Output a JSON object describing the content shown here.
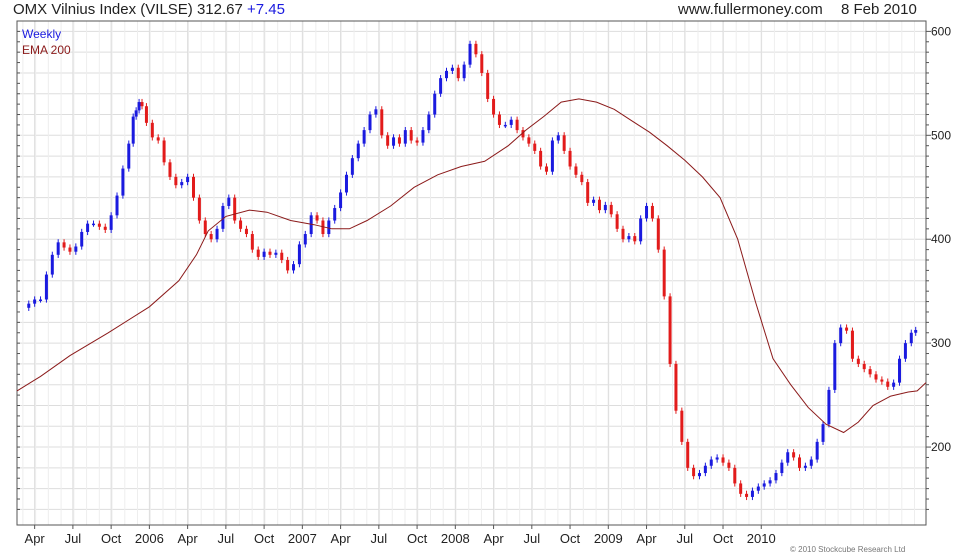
{
  "header": {
    "title": "OMX Vilnius Index (VILSE)",
    "last_price": "312.67",
    "change": "+7.45",
    "site": "www.fullermoney.com",
    "date": "8 Feb 2010"
  },
  "legend": {
    "weekly": "Weekly",
    "ema": "EMA 200"
  },
  "footer": {
    "copyright": "© 2010 Stockcube Research Ltd"
  },
  "colors": {
    "up": "#1a1adf",
    "down": "#e21b1b",
    "ema": "#8b1a1a",
    "grid": "#dddddd",
    "frame": "#555555"
  },
  "chart_data": {
    "type": "line",
    "title": "OMX Vilnius Index (VILSE)",
    "xlabel": "",
    "ylabel": "",
    "ylim": [
      125,
      610
    ],
    "y_ticks": [
      200,
      300,
      400,
      500,
      600
    ],
    "x_tick_labels": [
      "Apr",
      "Jul",
      "Oct",
      "2006",
      "Apr",
      "Jul",
      "Oct",
      "2007",
      "Apr",
      "Jul",
      "Oct",
      "2008",
      "Apr",
      "Jul",
      "Oct",
      "2009",
      "Apr",
      "Jul",
      "Oct",
      "2010"
    ],
    "x_tick_weeks": [
      3,
      16,
      29,
      42,
      55,
      68,
      81,
      94,
      107,
      120,
      133,
      146,
      159,
      172,
      185,
      198,
      211,
      224,
      237,
      250
    ],
    "grid": true,
    "series": [
      {
        "name": "Weekly",
        "points": [
          [
            0,
            334
          ],
          [
            2,
            338
          ],
          [
            4,
            342
          ],
          [
            6,
            342
          ],
          [
            8,
            366
          ],
          [
            10,
            385
          ],
          [
            12,
            397
          ],
          [
            14,
            392
          ],
          [
            16,
            388
          ],
          [
            18,
            393
          ],
          [
            20,
            407
          ],
          [
            22,
            415
          ],
          [
            24,
            415
          ],
          [
            26,
            412
          ],
          [
            28,
            409
          ],
          [
            30,
            423
          ],
          [
            32,
            442
          ],
          [
            34,
            468
          ],
          [
            36,
            492
          ],
          [
            37,
            518
          ],
          [
            38,
            524
          ],
          [
            39,
            532
          ],
          [
            40,
            528
          ],
          [
            42,
            512
          ],
          [
            44,
            498
          ],
          [
            46,
            495
          ],
          [
            48,
            474
          ],
          [
            50,
            460
          ],
          [
            52,
            452
          ],
          [
            54,
            455
          ],
          [
            56,
            460
          ],
          [
            58,
            440
          ],
          [
            60,
            418
          ],
          [
            62,
            405
          ],
          [
            64,
            400
          ],
          [
            66,
            410
          ],
          [
            68,
            432
          ],
          [
            70,
            440
          ],
          [
            72,
            418
          ],
          [
            74,
            410
          ],
          [
            76,
            405
          ],
          [
            78,
            390
          ],
          [
            80,
            383
          ],
          [
            82,
            388
          ],
          [
            84,
            385
          ],
          [
            86,
            387
          ],
          [
            88,
            380
          ],
          [
            90,
            370
          ],
          [
            92,
            376
          ],
          [
            94,
            395
          ],
          [
            96,
            405
          ],
          [
            98,
            423
          ],
          [
            100,
            418
          ],
          [
            102,
            405
          ],
          [
            104,
            418
          ],
          [
            106,
            430
          ],
          [
            108,
            445
          ],
          [
            110,
            462
          ],
          [
            112,
            478
          ],
          [
            114,
            492
          ],
          [
            116,
            505
          ],
          [
            118,
            520
          ],
          [
            120,
            525
          ],
          [
            122,
            500
          ],
          [
            124,
            490
          ],
          [
            126,
            498
          ],
          [
            128,
            492
          ],
          [
            130,
            505
          ],
          [
            132,
            495
          ],
          [
            134,
            493
          ],
          [
            136,
            505
          ],
          [
            138,
            520
          ],
          [
            140,
            540
          ],
          [
            142,
            555
          ],
          [
            144,
            562
          ],
          [
            146,
            565
          ],
          [
            148,
            555
          ],
          [
            150,
            568
          ],
          [
            152,
            588
          ],
          [
            154,
            578
          ],
          [
            156,
            560
          ],
          [
            158,
            535
          ],
          [
            160,
            520
          ],
          [
            162,
            510
          ],
          [
            164,
            510
          ],
          [
            166,
            515
          ],
          [
            168,
            505
          ],
          [
            170,
            498
          ],
          [
            172,
            492
          ],
          [
            174,
            485
          ],
          [
            176,
            470
          ],
          [
            178,
            465
          ],
          [
            180,
            495
          ],
          [
            182,
            500
          ],
          [
            184,
            485
          ],
          [
            186,
            470
          ],
          [
            188,
            462
          ],
          [
            190,
            455
          ],
          [
            192,
            435
          ],
          [
            194,
            438
          ],
          [
            196,
            428
          ],
          [
            198,
            433
          ],
          [
            200,
            424
          ],
          [
            202,
            410
          ],
          [
            204,
            400
          ],
          [
            206,
            403
          ],
          [
            208,
            398
          ],
          [
            210,
            420
          ],
          [
            212,
            432
          ],
          [
            214,
            420
          ],
          [
            216,
            390
          ],
          [
            218,
            345
          ],
          [
            220,
            280
          ],
          [
            222,
            235
          ],
          [
            224,
            205
          ],
          [
            226,
            180
          ],
          [
            228,
            172
          ],
          [
            230,
            175
          ],
          [
            232,
            182
          ],
          [
            234,
            188
          ],
          [
            236,
            190
          ],
          [
            238,
            185
          ],
          [
            240,
            180
          ],
          [
            242,
            165
          ],
          [
            244,
            155
          ],
          [
            246,
            152
          ],
          [
            248,
            158
          ],
          [
            250,
            162
          ],
          [
            252,
            165
          ],
          [
            254,
            168
          ],
          [
            256,
            175
          ],
          [
            258,
            185
          ],
          [
            260,
            195
          ],
          [
            262,
            190
          ],
          [
            264,
            180
          ],
          [
            266,
            182
          ],
          [
            268,
            188
          ],
          [
            270,
            205
          ],
          [
            272,
            222
          ],
          [
            274,
            255
          ],
          [
            276,
            300
          ],
          [
            278,
            315
          ],
          [
            280,
            312
          ],
          [
            282,
            285
          ],
          [
            284,
            280
          ],
          [
            286,
            275
          ],
          [
            288,
            270
          ],
          [
            290,
            265
          ],
          [
            292,
            263
          ],
          [
            294,
            258
          ],
          [
            296,
            262
          ],
          [
            298,
            285
          ],
          [
            300,
            300
          ],
          [
            302,
            310
          ],
          [
            303,
            312.67
          ]
        ]
      },
      {
        "name": "EMA 200",
        "points": [
          [
            -3,
            254
          ],
          [
            5,
            268
          ],
          [
            15,
            288
          ],
          [
            28,
            310
          ],
          [
            42,
            335
          ],
          [
            52,
            360
          ],
          [
            58,
            385
          ],
          [
            62,
            408
          ],
          [
            68,
            422
          ],
          [
            76,
            428
          ],
          [
            82,
            426
          ],
          [
            90,
            418
          ],
          [
            98,
            414
          ],
          [
            104,
            410
          ],
          [
            110,
            410
          ],
          [
            116,
            418
          ],
          [
            124,
            432
          ],
          [
            132,
            450
          ],
          [
            140,
            462
          ],
          [
            148,
            470
          ],
          [
            156,
            475
          ],
          [
            164,
            490
          ],
          [
            170,
            505
          ],
          [
            176,
            518
          ],
          [
            182,
            532
          ],
          [
            188,
            535
          ],
          [
            194,
            532
          ],
          [
            200,
            525
          ],
          [
            206,
            514
          ],
          [
            212,
            503
          ],
          [
            218,
            490
          ],
          [
            224,
            476
          ],
          [
            230,
            460
          ],
          [
            236,
            440
          ],
          [
            242,
            400
          ],
          [
            248,
            340
          ],
          [
            254,
            285
          ],
          [
            260,
            260
          ],
          [
            266,
            238
          ],
          [
            272,
            222
          ],
          [
            278,
            214
          ],
          [
            283,
            224
          ],
          [
            288,
            240
          ],
          [
            294,
            249
          ],
          [
            300,
            253
          ],
          [
            303,
            254
          ],
          [
            306,
            262
          ]
        ]
      }
    ]
  }
}
